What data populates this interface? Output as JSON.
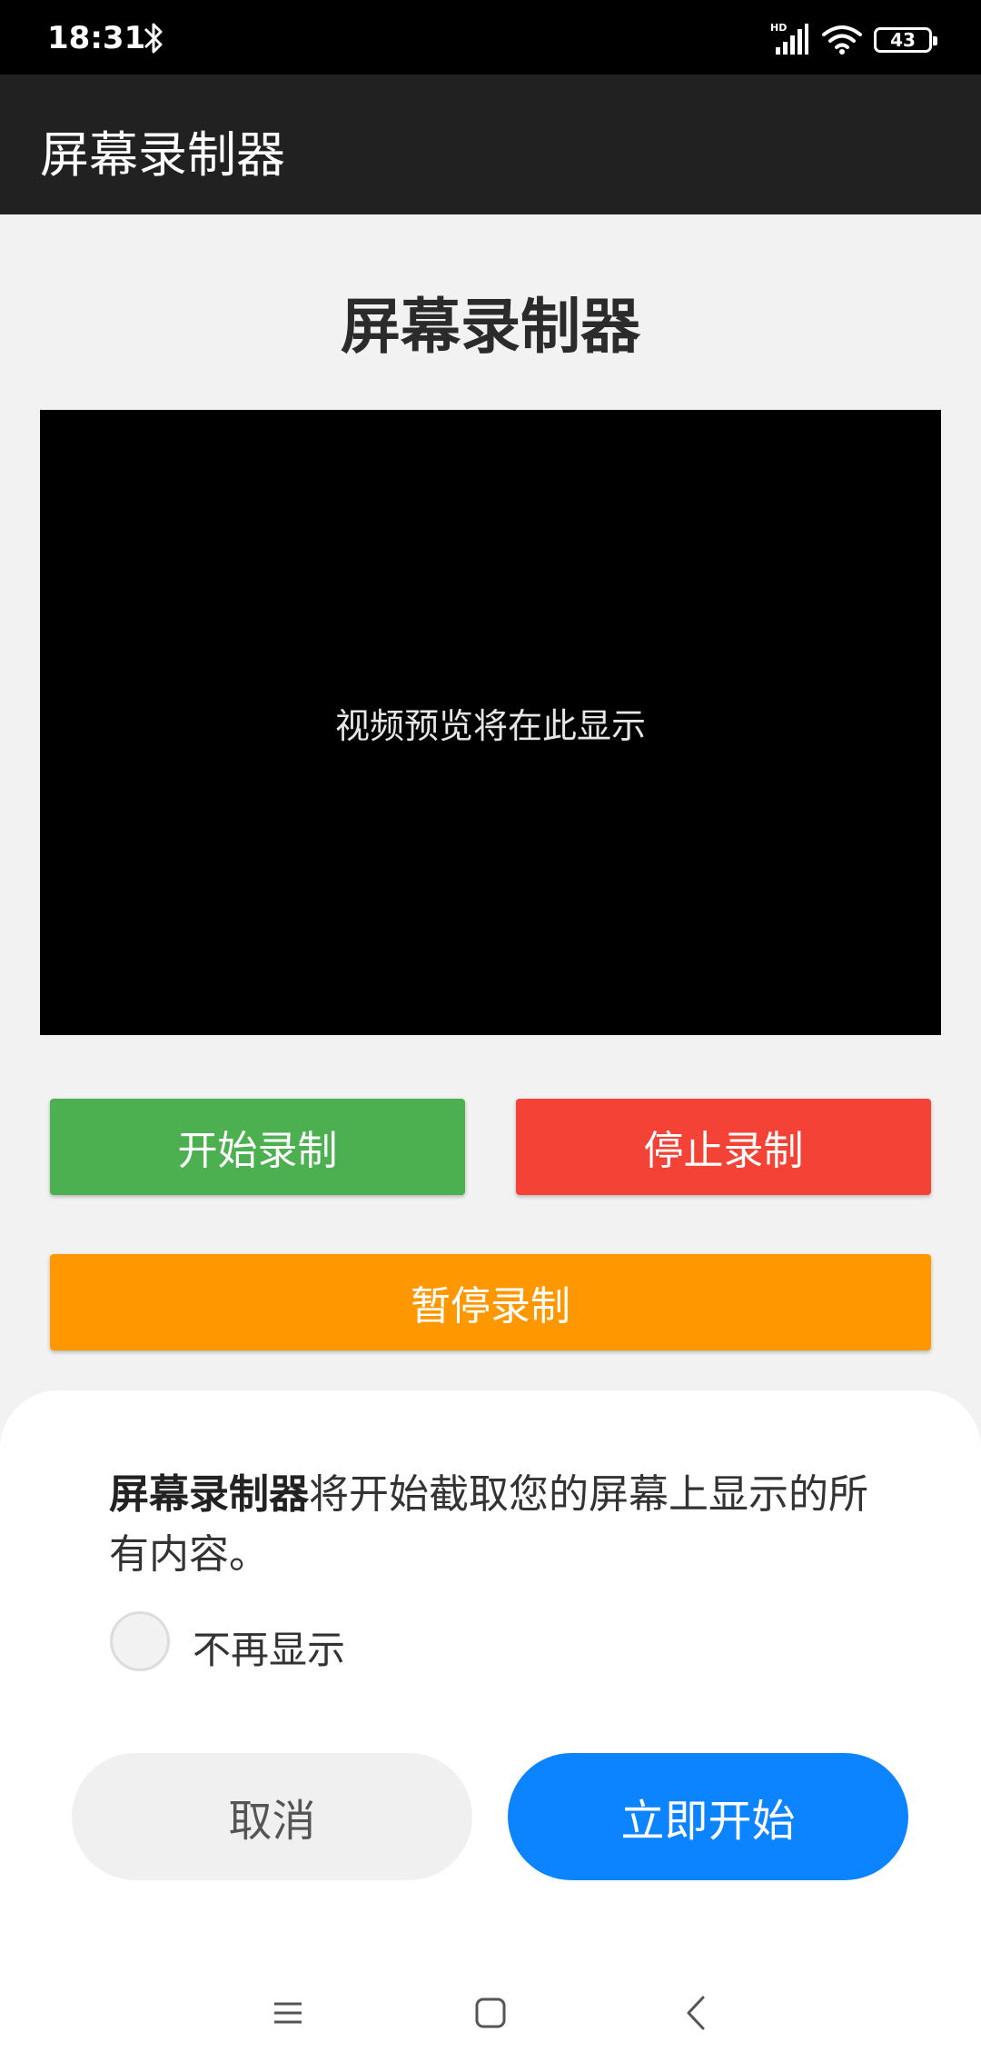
{
  "status_bar": {
    "time": "18:31",
    "battery": "43"
  },
  "app_bar": {
    "title": "屏幕录制器"
  },
  "main": {
    "heading": "屏幕录制器",
    "preview_text": "视频预览将在此显示",
    "buttons": {
      "start": "开始录制",
      "stop": "停止录制",
      "pause": "暂停录制"
    }
  },
  "dialog": {
    "app_name": "屏幕录制器",
    "message": "将开始截取您的屏幕上显示的所有内容。",
    "checkbox_label": "不再显示",
    "cancel": "取消",
    "confirm": "立即开始"
  },
  "colors": {
    "start": "#4caf50",
    "stop": "#f44336",
    "pause": "#ff9800",
    "confirm": "#0d84ff"
  },
  "icons": [
    "bluetooth-icon",
    "signal-icon",
    "wifi-icon",
    "battery-icon",
    "menu-icon",
    "home-icon",
    "back-icon"
  ]
}
